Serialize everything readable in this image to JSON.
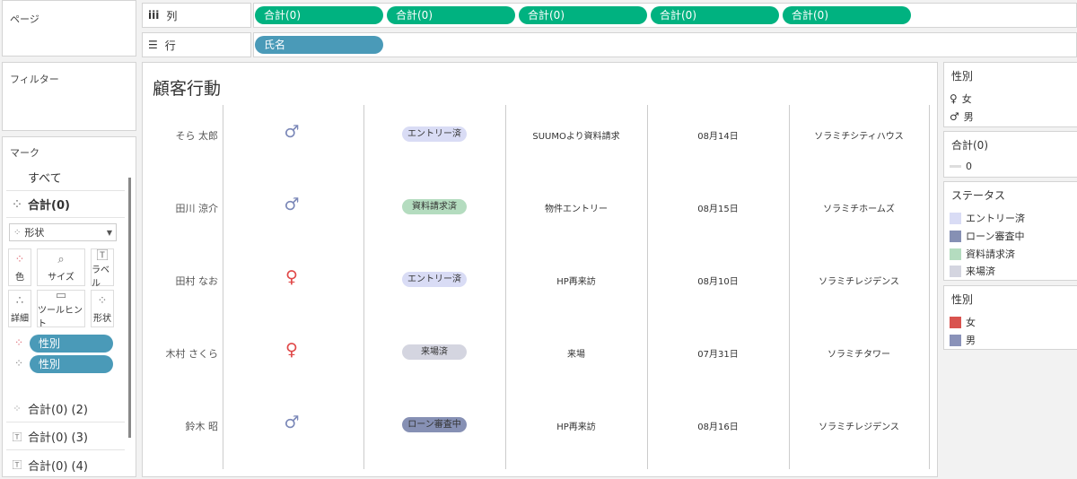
{
  "left_panel": {
    "pages_title": "ページ",
    "filters_title": "フィルター",
    "marks_title": "マーク",
    "mark_rows": [
      {
        "label": "すべて",
        "icon": ""
      },
      {
        "label": "合計(0)",
        "icon": "shape-icon"
      }
    ],
    "mark_type": "形状",
    "mark_buttons": [
      {
        "label": "色",
        "icon": "color-icon"
      },
      {
        "label": "サイズ",
        "icon": "size-icon"
      },
      {
        "label": "ラベル",
        "icon": "label-icon"
      },
      {
        "label": "詳細",
        "icon": "detail-icon"
      },
      {
        "label": "ツールヒント",
        "icon": "tooltip-icon"
      },
      {
        "label": "形状",
        "icon": "shape-icon"
      }
    ],
    "mark_pills": [
      "性別",
      "性別"
    ],
    "extra_marks": [
      {
        "label": "合計(0) (2)",
        "icon": "shape-icon"
      },
      {
        "label": "合計(0) (3)",
        "icon": "text-icon"
      },
      {
        "label": "合計(0) (4)",
        "icon": "text-icon"
      }
    ]
  },
  "shelves": {
    "columns_label": "列",
    "rows_label": "行",
    "column_pills": [
      "合計(0)",
      "合計(0)",
      "合計(0)",
      "合計(0)",
      "合計(0)"
    ],
    "row_pills": [
      "氏名"
    ]
  },
  "viz": {
    "title": "顧客行動",
    "rows": [
      {
        "name": "そら 太郎",
        "gender": "male",
        "status": "エントリー済",
        "status_key": "entry",
        "action": "SUUMOより資料請求",
        "date": "08月14日",
        "property": "ソラミチシティハウス"
      },
      {
        "name": "田川 涼介",
        "gender": "male",
        "status": "資料請求済",
        "status_key": "doc",
        "action": "物件エントリー",
        "date": "08月15日",
        "property": "ソラミチホームズ"
      },
      {
        "name": "田村 なお",
        "gender": "female",
        "status": "エントリー済",
        "status_key": "entry",
        "action": "HP再来訪",
        "date": "08月10日",
        "property": "ソラミチレジデンス"
      },
      {
        "name": "木村 さくら",
        "gender": "female",
        "status": "来場済",
        "status_key": "visit",
        "action": "来場",
        "date": "07月31日",
        "property": "ソラミチタワー"
      },
      {
        "name": "鈴木 昭",
        "gender": "male",
        "status": "ローン審査中",
        "status_key": "loan",
        "action": "HP再来訪",
        "date": "08月16日",
        "property": "ソラミチレジデンス"
      }
    ]
  },
  "legends": {
    "gender_shape": {
      "title": "性別",
      "items": [
        "女",
        "男"
      ]
    },
    "sum": {
      "title": "合計(0)",
      "items": [
        "0"
      ]
    },
    "status": {
      "title": "ステータス",
      "items": [
        {
          "label": "エントリー済",
          "color": "#d9dcf5"
        },
        {
          "label": "ローン審査中",
          "color": "#8690b4"
        },
        {
          "label": "資料請求済",
          "color": "#b4dcbf"
        },
        {
          "label": "来場済",
          "color": "#d4d5e0"
        }
      ]
    },
    "gender_color": {
      "title": "性別",
      "items": [
        {
          "label": "女",
          "color": "#d9534f"
        },
        {
          "label": "男",
          "color": "#8a92b9"
        }
      ]
    }
  },
  "colors": {
    "pill_green": "#00b280",
    "pill_blue": "#4a9ab8",
    "male": "#7b88b8",
    "female": "#e04848"
  }
}
